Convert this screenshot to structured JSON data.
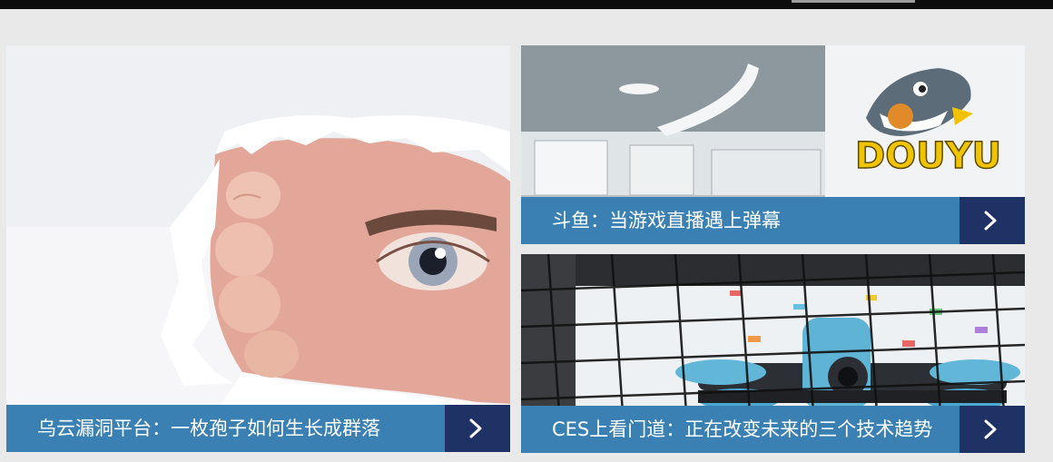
{
  "cards": [
    {
      "title": "乌云漏洞平台：一枚孢子如何生长成群落",
      "image": "torn-paper-eye-photo"
    },
    {
      "title": "斗鱼：当游戏直播遇上弹幕",
      "image": "douyu-office-photo",
      "logo_text": "DOUYU"
    },
    {
      "title": "CES上看门道：正在改变未来的三个技术趋势",
      "image": "drone-cage-photo"
    }
  ],
  "icons": {
    "next": "chevron-right-icon"
  }
}
